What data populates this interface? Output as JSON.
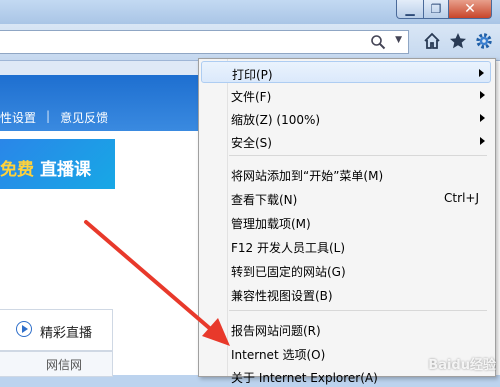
{
  "window": {
    "min_icon": "minimize-icon",
    "max_icon": "maximize-icon",
    "close_icon": "close-icon",
    "close_glyph": "✕"
  },
  "toolbar": {
    "icons": [
      "search-icon",
      "home-icon",
      "favorites-star-icon",
      "gear-icon"
    ]
  },
  "page": {
    "links": [
      "性设置",
      "意见反馈"
    ],
    "banner": {
      "gift": "免费",
      "live": "直播课"
    },
    "live_button": "精彩直播",
    "bottom_text": "网信网"
  },
  "menu": {
    "items": [
      {
        "label": "打印(P)",
        "submenu": true
      },
      {
        "label": "文件(F)",
        "submenu": true
      },
      {
        "label": "缩放(Z) (100%)",
        "submenu": true
      },
      {
        "label": "安全(S)",
        "submenu": true
      },
      {
        "label": "将网站添加到“开始”菜单(M)"
      },
      {
        "label": "查看下载(N)",
        "shortcut": "Ctrl+J"
      },
      {
        "label": "管理加载项(M)"
      },
      {
        "label": "F12 开发人员工具(L)"
      },
      {
        "label": "转到已固定的网站(G)"
      },
      {
        "label": "兼容性视图设置(B)"
      },
      {
        "label": "报告网站问题(R)"
      },
      {
        "label": "Internet 选项(O)"
      },
      {
        "label": "关于 Internet Explorer(A)"
      }
    ]
  },
  "watermark": "Baidu经验",
  "colors": {
    "accent": "#1e6fd0",
    "arrow": "#e8392b",
    "close": "#c8452a"
  }
}
